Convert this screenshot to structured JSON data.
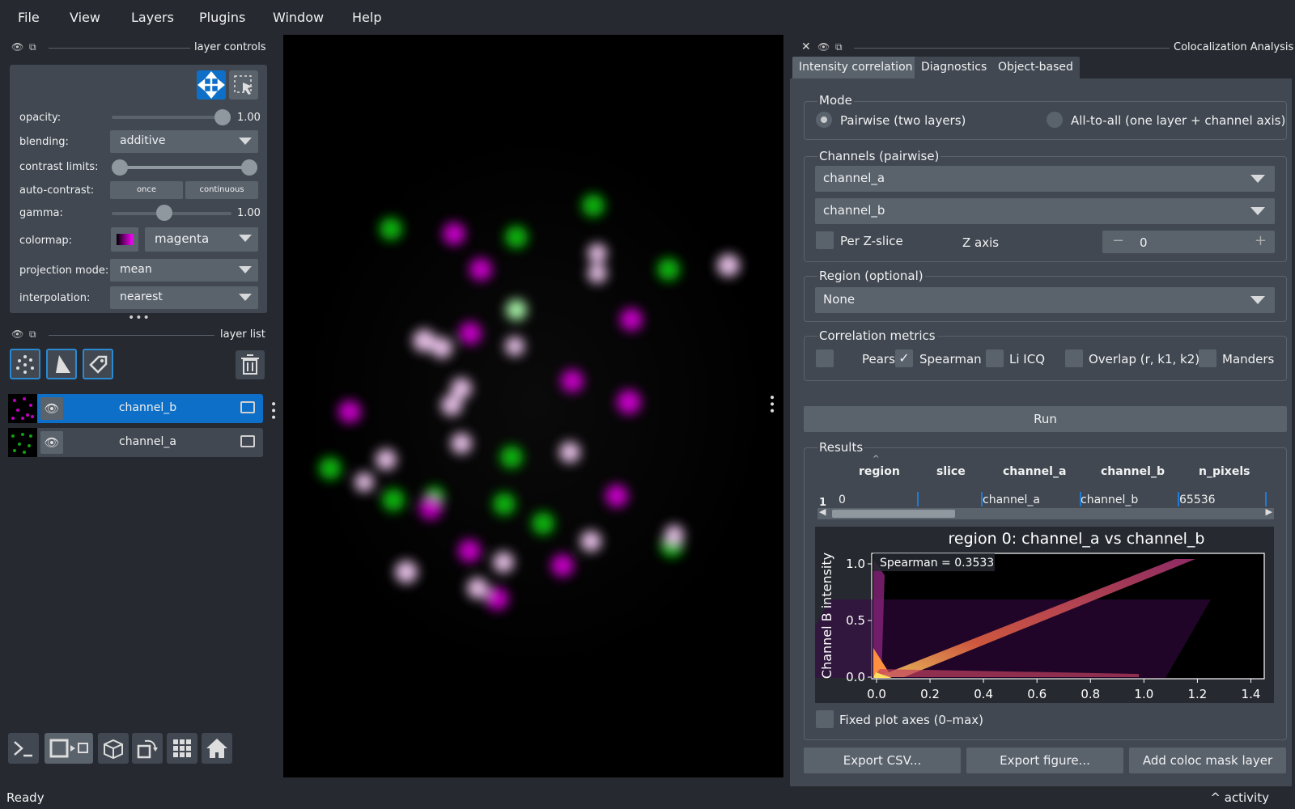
{
  "menubar": {
    "items": [
      "File",
      "View",
      "Layers",
      "Plugins",
      "Window",
      "Help"
    ]
  },
  "left_dock": {
    "controls_title": "layer controls",
    "list_title": "layer list",
    "controls": {
      "opacity_label": "opacity:",
      "opacity_value": "1.00",
      "opacity_fraction": 1.0,
      "blending_label": "blending:",
      "blending_value": "additive",
      "contrast_label": "contrast limits:",
      "autocontrast_label": "auto-contrast:",
      "once": "once",
      "continuous": "continuous",
      "gamma_label": "gamma:",
      "gamma_value": "1.00",
      "colormap_label": "colormap:",
      "colormap_value": "magenta",
      "projection_label": "projection mode:",
      "projection_value": "mean",
      "interpolation_label": "interpolation:",
      "interpolation_value": "nearest"
    },
    "layers": [
      {
        "name": "channel_b",
        "selected": true
      },
      {
        "name": "channel_a",
        "selected": false
      }
    ]
  },
  "right_dock": {
    "title": "Colocalization Analysis",
    "tabs": [
      "Intensity correlation",
      "Diagnostics",
      "Object-based"
    ],
    "mode": {
      "title": "Mode",
      "pairwise": "Pairwise (two layers)",
      "all": "All-to-all (one layer + channel axis)"
    },
    "channels": {
      "title": "Channels (pairwise)",
      "a": "channel_a",
      "b": "channel_b",
      "per_z": "Per Z-slice",
      "z_axis": "Z axis",
      "z_value": "0",
      "minus": "−",
      "plus": "+"
    },
    "region": {
      "title": "Region (optional)",
      "value": "None"
    },
    "metrics": {
      "title": "Correlation metrics",
      "items": [
        {
          "label": "Pearson",
          "checked": false
        },
        {
          "label": "Spearman",
          "checked": true
        },
        {
          "label": "Li ICQ",
          "checked": false
        },
        {
          "label": "Overlap (r, k1, k2)",
          "checked": false
        },
        {
          "label": "Manders",
          "checked": false
        }
      ]
    },
    "run": "Run",
    "results": {
      "title": "Results",
      "sort_caret": "^",
      "headers": [
        "region",
        "slice",
        "channel_a",
        "channel_b",
        "n_pixels"
      ],
      "row_index": "1",
      "row": [
        "0",
        "",
        "channel_a",
        "channel_b",
        "65536"
      ]
    },
    "fixed_axes": "Fixed plot axes (0–max)",
    "buttons": {
      "export_csv": "Export CSV...",
      "export_fig": "Export figure...",
      "add_mask": "Add coloc mask layer"
    }
  },
  "chart_data": {
    "type": "heatmap",
    "title": "region 0: channel_a vs channel_b",
    "xlabel": "",
    "ylabel": "Channel B intensity",
    "xlim": [
      0,
      1.45
    ],
    "ylim": [
      0,
      1.1
    ],
    "xticks": [
      "0.0",
      "0.2",
      "0.4",
      "0.6",
      "0.8",
      "1.0",
      "1.2",
      "1.4"
    ],
    "yticks": [
      "0.0",
      "0.5",
      "1.0"
    ],
    "annotation": "Spearman = 0.3533"
  },
  "status": {
    "left": "Ready",
    "right": "^ activity"
  },
  "colors": {
    "accent": "#0d6fc7",
    "panel": "#414851",
    "bg": "#262930",
    "magenta": "#d000d0",
    "green": "#20c020"
  }
}
